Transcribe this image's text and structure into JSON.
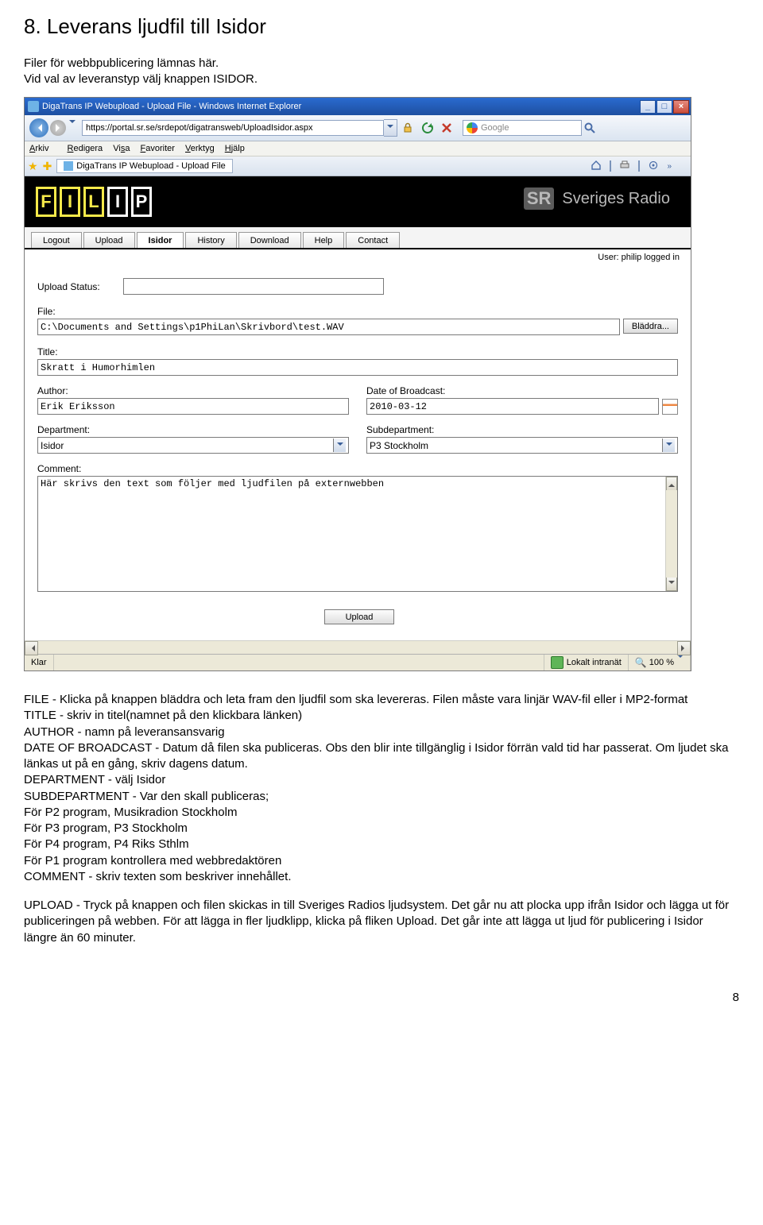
{
  "doc": {
    "heading": "8. Leverans ljudfil till Isidor",
    "intro_line1": "Filer för webbpublicering lämnas här.",
    "intro_line2": "Vid val av leveranstyp välj knappen ISIDOR.",
    "page_number": "8"
  },
  "browser": {
    "window_title": "DigaTrans IP Webupload - Upload File - Windows Internet Explorer",
    "address": "https://portal.sr.se/srdepot/digatransweb/UploadIsidor.aspx",
    "search_placeholder": "Google",
    "tab_title": "DigaTrans IP Webupload - Upload File",
    "menu": {
      "arkiv": "Arkiv",
      "redigera": "Redigera",
      "visa": "Visa",
      "favoriter": "Favoriter",
      "verktyg": "Verktyg",
      "hjalp": "Hjälp"
    },
    "status": {
      "left": "Klar",
      "zone": "Lokalt intranät",
      "zoom": "100 %"
    },
    "chevron": "»"
  },
  "page": {
    "brand": "Sveriges Radio",
    "brand_mark": "SR",
    "tabs": {
      "logout": "Logout",
      "upload": "Upload",
      "isidor": "Isidor",
      "history": "History",
      "download": "Download",
      "help": "Help",
      "contact": "Contact"
    },
    "user_line": "User: philip logged in",
    "labels": {
      "upload_status": "Upload Status:",
      "file": "File:",
      "browse": "Bläddra...",
      "title": "Title:",
      "author": "Author:",
      "date_broadcast": "Date of Broadcast:",
      "department": "Department:",
      "subdepartment": "Subdepartment:",
      "comment": "Comment:",
      "upload_btn": "Upload"
    },
    "values": {
      "file": "C:\\Documents and Settings\\p1PhiLan\\Skrivbord\\test.WAV",
      "title": "Skratt i Humorhimlen",
      "author": "Erik Eriksson",
      "date_broadcast": "2010-03-12",
      "department": "Isidor",
      "subdepartment": "P3 Stockholm",
      "comment": "Här skrivs den text som följer med ljudfilen på externwebben"
    }
  },
  "explain": {
    "p1_a": "FILE - Klicka på knappen bläddra och leta fram den ljudfil som ska levereras. Filen måste vara linjär WAV-fil eller i MP2-format",
    "p1_b": "TITLE - skriv in titel(namnet på den klickbara länken)",
    "p1_c": "AUTHOR - namn på leveransansvarig",
    "p1_d": "DATE OF BROADCAST - Datum då filen ska publiceras. Obs den blir inte tillgänglig i Isidor förrän vald tid har passerat. Om ljudet ska länkas ut på en gång, skriv dagens datum.",
    "p1_e": "DEPARTMENT - välj Isidor",
    "p1_f": "SUBDEPARTMENT - Var den skall publiceras;",
    "p1_g": "För P2 program, Musikradion Stockholm",
    "p1_h": "För P3 program, P3 Stockholm",
    "p1_i": "För P4 program, P4 Riks Sthlm",
    "p1_j": "För P1 program kontrollera med webbredaktören",
    "p1_k": "COMMENT - skriv texten som beskriver innehållet.",
    "p2": "UPLOAD - Tryck på knappen och filen skickas in till Sveriges Radios ljudsystem. Det går nu att plocka upp ifrån Isidor och lägga ut för publiceringen på webben. För att lägga in fler ljudklipp, klicka på fliken Upload. Det går inte att lägga ut ljud för publicering i Isidor längre än 60 minuter."
  }
}
